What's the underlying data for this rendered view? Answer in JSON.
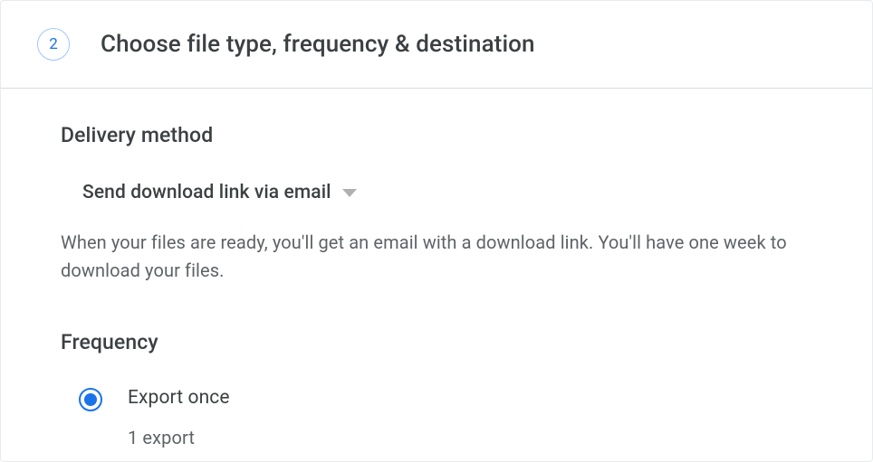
{
  "header": {
    "step": "2",
    "title": "Choose file type, frequency & destination"
  },
  "delivery": {
    "label": "Delivery method",
    "selected": "Send download link via email",
    "description": "When your files are ready, you'll get an email with a download link. You'll have one week to download your files."
  },
  "frequency": {
    "label": "Frequency",
    "options": [
      {
        "label": "Export once",
        "sublabel": "1 export",
        "selected": true
      }
    ]
  }
}
